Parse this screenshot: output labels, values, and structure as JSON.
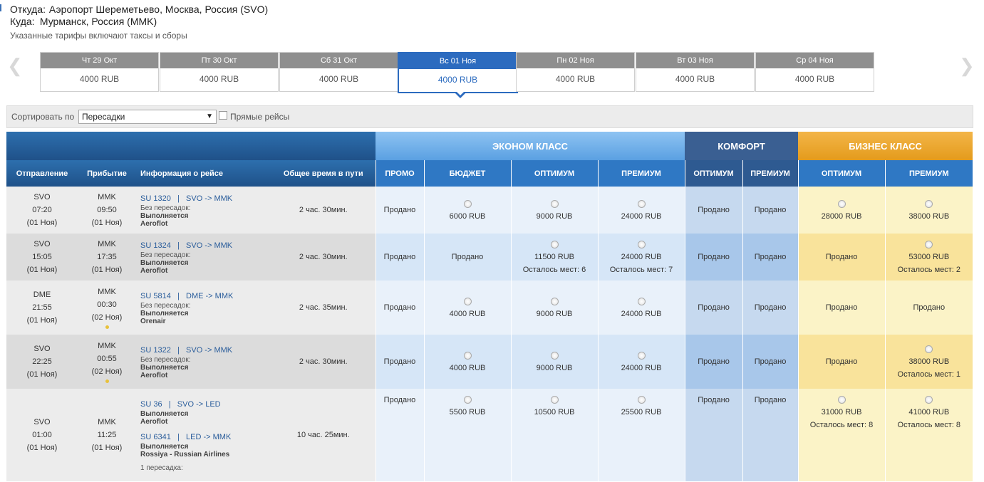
{
  "route": {
    "from_label": "Откуда:",
    "from_value": "Аэропорт Шереметьево, Москва, Россия (SVO)",
    "to_label": "Куда:",
    "to_value": "Мурманск, Россия (MMK)",
    "note": "Указанные тарифы включают таксы и сборы"
  },
  "dates": [
    {
      "day": "Чт 29 Окт",
      "price": "4000 RUB"
    },
    {
      "day": "Пт 30 Окт",
      "price": "4000 RUB"
    },
    {
      "day": "Сб 31 Окт",
      "price": "4000 RUB"
    },
    {
      "day": "Вс 01 Ноя",
      "price": "4000 RUB",
      "active": true
    },
    {
      "day": "Пн 02 Ноя",
      "price": "4000 RUB"
    },
    {
      "day": "Вт 03 Ноя",
      "price": "4000 RUB"
    },
    {
      "day": "Ср 04 Ноя",
      "price": "4000 RUB"
    }
  ],
  "nav": {
    "prev": "❮",
    "next": "❯"
  },
  "sort": {
    "label": "Сортировать по",
    "value": "Пересадки",
    "arrow": "▼",
    "direct_label": "Прямые рейсы"
  },
  "header": {
    "departure": "Отправление",
    "arrival": "Прибытие",
    "info": "Информация о рейсе",
    "duration": "Общее время в пути",
    "economy": "ЭКОНОМ КЛАСС",
    "comfort": "КОМФОРТ",
    "business": "БИЗНЕС КЛАСС",
    "eco_promo": "ПРОМО",
    "eco_budget": "БЮДЖЕТ",
    "eco_optimum": "ОПТИМУМ",
    "eco_premium": "ПРЕМИУМ",
    "com_optimum": "ОПТИМУМ",
    "com_premium": "ПРЕМИУМ",
    "biz_optimum": "ОПТИМУМ",
    "biz_premium": "ПРЕМИУМ"
  },
  "rows": [
    {
      "dep_code": "SVO",
      "dep_time": "07:20",
      "dep_date": "(01 Ноя)",
      "arr_code": "MMK",
      "arr_time": "09:50",
      "arr_date": "(01 Ноя)",
      "segments": [
        {
          "no": "SU 1320",
          "sep": "|",
          "route": "SVO -> MMK",
          "stops": "Без пересадок:",
          "operated": "Выполняется",
          "carrier": "Aeroflot"
        }
      ],
      "duration": "2 час. 30мин.",
      "fares": [
        {
          "price": "Продано"
        },
        {
          "price": "6000 RUB",
          "radio": true
        },
        {
          "price": "9000 RUB",
          "radio": true
        },
        {
          "price": "24000 RUB",
          "radio": true
        },
        {
          "price": "Продано"
        },
        {
          "price": "Продано"
        },
        {
          "price": "28000 RUB",
          "radio": true
        },
        {
          "price": "38000 RUB",
          "radio": true
        }
      ]
    },
    {
      "dep_code": "SVO",
      "dep_time": "15:05",
      "dep_date": "(01 Ноя)",
      "arr_code": "MMK",
      "arr_time": "17:35",
      "arr_date": "(01 Ноя)",
      "segments": [
        {
          "no": "SU 1324",
          "sep": "|",
          "route": "SVO -> MMK",
          "stops": "Без пересадок:",
          "operated": "Выполняется",
          "carrier": "Aeroflot"
        }
      ],
      "duration": "2 час. 30мин.",
      "fares": [
        {
          "price": "Продано"
        },
        {
          "price": "Продано"
        },
        {
          "price": "11500 RUB",
          "radio": true,
          "seats": "Осталось мест: 6"
        },
        {
          "price": "24000 RUB",
          "radio": true,
          "seats": "Осталось мест: 7"
        },
        {
          "price": "Продано"
        },
        {
          "price": "Продано"
        },
        {
          "price": "Продано"
        },
        {
          "price": "53000 RUB",
          "radio": true,
          "seats": "Осталось мест: 2"
        }
      ]
    },
    {
      "dep_code": "DME",
      "dep_time": "21:55",
      "dep_date": "(01 Ноя)",
      "arr_code": "MMK",
      "arr_time": "00:30",
      "arr_date": "(02 Ноя)",
      "arr_dot": true,
      "segments": [
        {
          "no": "SU 5814",
          "sep": "|",
          "route": "DME -> MMK",
          "stops": "Без пересадок:",
          "operated": "Выполняется",
          "carrier": "Orenair"
        }
      ],
      "duration": "2 час. 35мин.",
      "fares": [
        {
          "price": "Продано"
        },
        {
          "price": "4000 RUB",
          "radio": true
        },
        {
          "price": "9000 RUB",
          "radio": true
        },
        {
          "price": "24000 RUB",
          "radio": true
        },
        {
          "price": "Продано"
        },
        {
          "price": "Продано"
        },
        {
          "price": "Продано"
        },
        {
          "price": "Продано"
        }
      ]
    },
    {
      "dep_code": "SVO",
      "dep_time": "22:25",
      "dep_date": "(01 Ноя)",
      "arr_code": "MMK",
      "arr_time": "00:55",
      "arr_date": "(02 Ноя)",
      "arr_dot": true,
      "segments": [
        {
          "no": "SU 1322",
          "sep": "|",
          "route": "SVO -> MMK",
          "stops": "Без пересадок:",
          "operated": "Выполняется",
          "carrier": "Aeroflot"
        }
      ],
      "duration": "2 час. 30мин.",
      "fares": [
        {
          "price": "Продано"
        },
        {
          "price": "4000 RUB",
          "radio": true
        },
        {
          "price": "9000 RUB",
          "radio": true
        },
        {
          "price": "24000 RUB",
          "radio": true
        },
        {
          "price": "Продано"
        },
        {
          "price": "Продано"
        },
        {
          "price": "Продано"
        },
        {
          "price": "38000 RUB",
          "radio": true,
          "seats": "Осталось мест: 1"
        }
      ]
    },
    {
      "dep_code": "SVO",
      "dep_time": "01:00",
      "dep_date": "(01 Ноя)",
      "arr_code": "MMK",
      "arr_time": "11:25",
      "arr_date": "(01 Ноя)",
      "segments": [
        {
          "no": "SU 36",
          "sep": "|",
          "route": "SVO -> LED",
          "stops": "",
          "operated": "Выполняется",
          "carrier": "Aeroflot"
        },
        {
          "no": "SU 6341",
          "sep": "|",
          "route": "LED -> MMK",
          "stops": "",
          "operated": "Выполняется",
          "carrier": "Rossiya - Russian Airlines"
        }
      ],
      "transfers": "1 пересадка:",
      "duration": "10 час. 25мин.",
      "fares": [
        {
          "price": "Продано"
        },
        {
          "price": "5500 RUB",
          "radio": true
        },
        {
          "price": "10500 RUB",
          "radio": true
        },
        {
          "price": "25500 RUB",
          "radio": true
        },
        {
          "price": "Продано"
        },
        {
          "price": "Продано"
        },
        {
          "price": "31000 RUB",
          "radio": true,
          "seats": "Осталось мест: 8"
        },
        {
          "price": "41000 RUB",
          "radio": true,
          "seats": "Осталось мест: 8"
        }
      ]
    }
  ]
}
